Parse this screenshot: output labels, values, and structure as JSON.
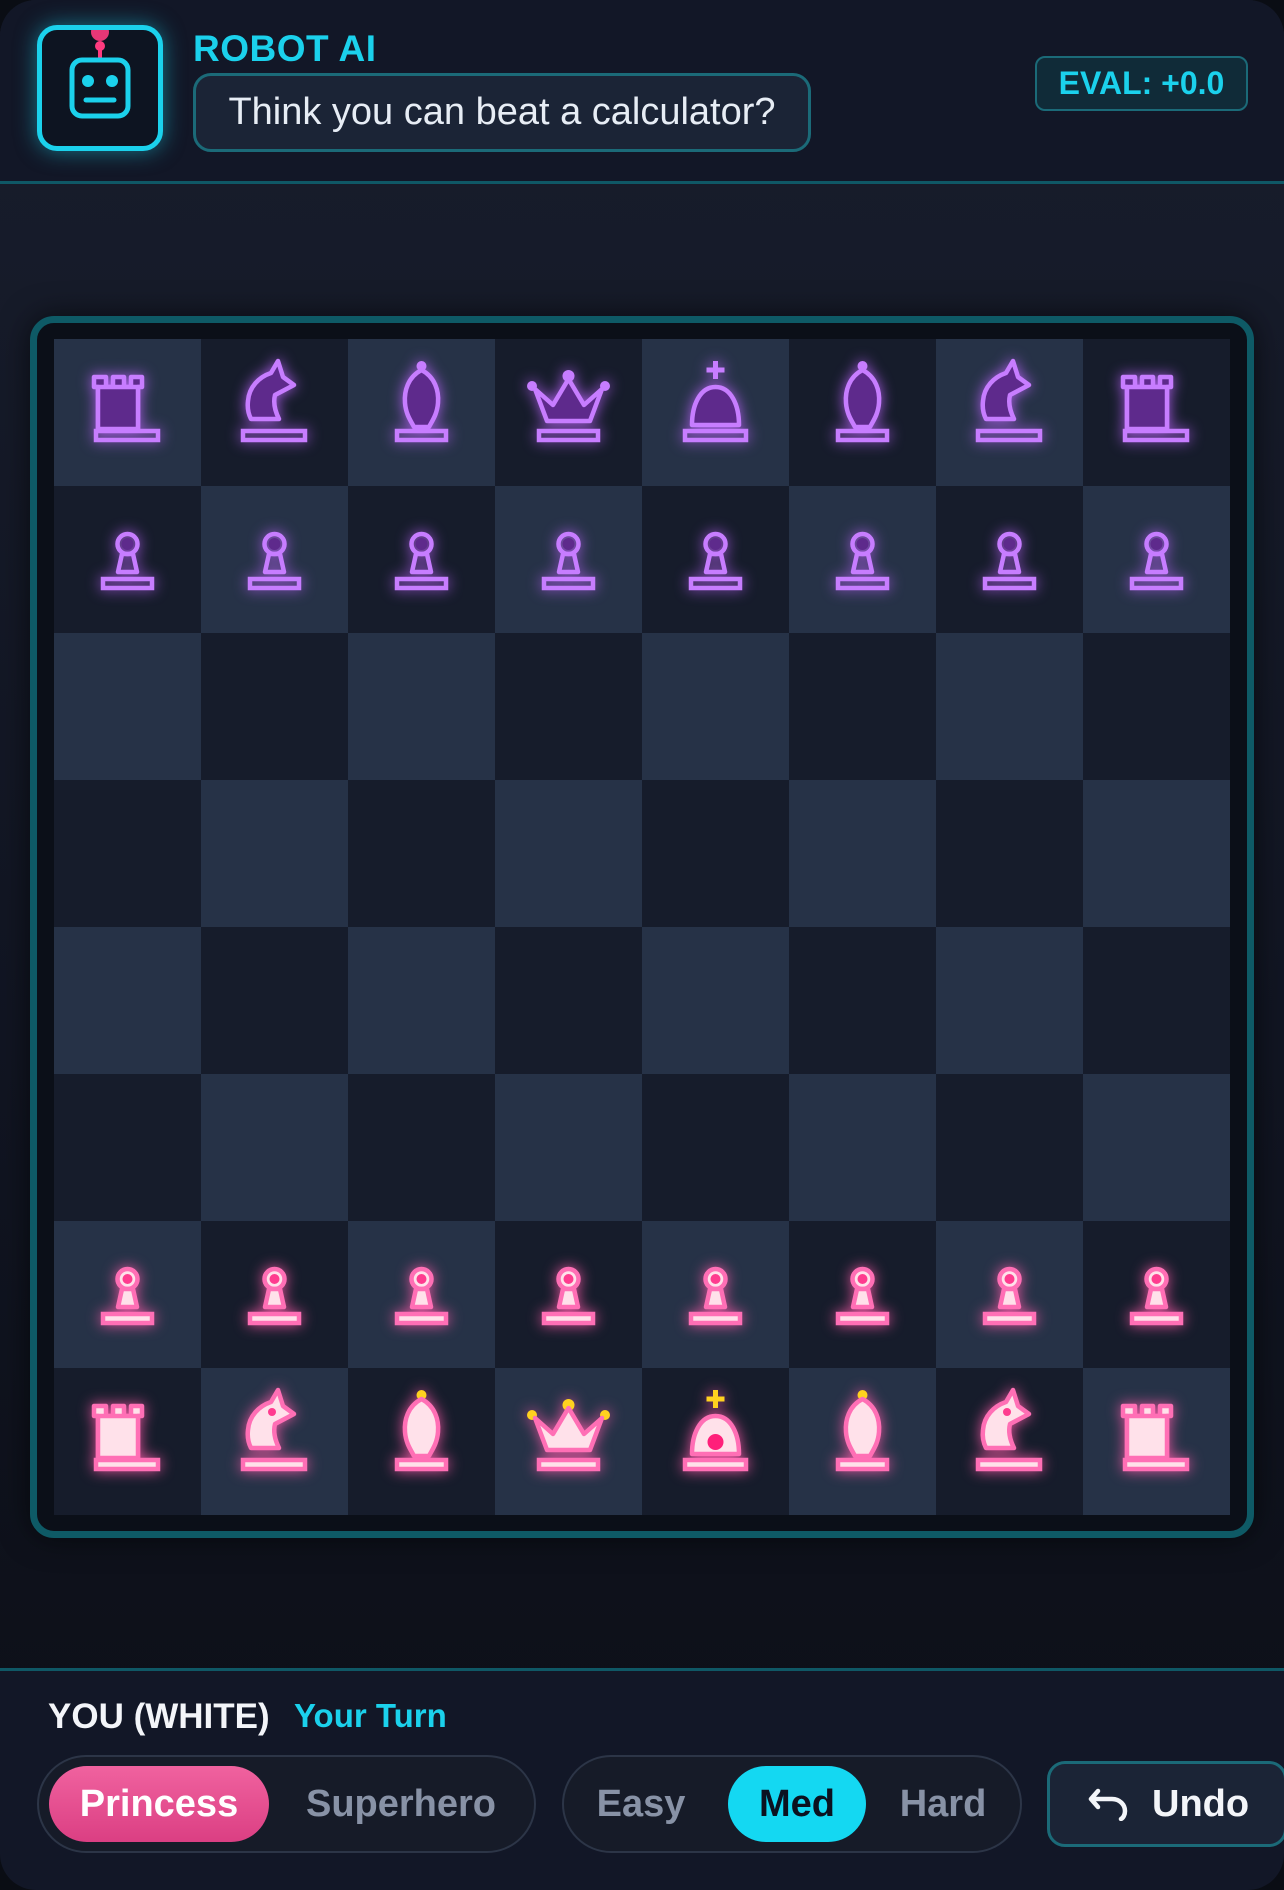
{
  "opponent": {
    "name": "ROBOT AI",
    "message": "Think you can beat a calculator?",
    "eval": "EVAL: +0.0",
    "avatar_icon": "robot-icon"
  },
  "player": {
    "label": "YOU (WHITE)",
    "status": "Your Turn"
  },
  "theme_toggle": {
    "options": [
      "Princess",
      "Superhero"
    ],
    "selected": "Princess"
  },
  "difficulty": {
    "options": [
      "Easy",
      "Med",
      "Hard"
    ],
    "selected": "Med"
  },
  "undo": {
    "label": "Undo",
    "icon": "undo-arrow-icon"
  },
  "colors": {
    "accent_cyan": "#1bd1ec",
    "accent_pink": "#ee5a9a",
    "black_pieces": "#c77dff",
    "white_pieces": "#ff6fb5",
    "light_square": "#263247",
    "dark_square": "#161c2b"
  },
  "board": {
    "ranks": [
      [
        "bR",
        "bN",
        "bB",
        "bQ",
        "bK",
        "bB",
        "bN",
        "bR"
      ],
      [
        "bP",
        "bP",
        "bP",
        "bP",
        "bP",
        "bP",
        "bP",
        "bP"
      ],
      [
        "",
        "",
        "",
        "",
        "",
        "",
        "",
        ""
      ],
      [
        "",
        "",
        "",
        "",
        "",
        "",
        "",
        ""
      ],
      [
        "",
        "",
        "",
        "",
        "",
        "",
        "",
        ""
      ],
      [
        "",
        "",
        "",
        "",
        "",
        "",
        "",
        ""
      ],
      [
        "wP",
        "wP",
        "wP",
        "wP",
        "wP",
        "wP",
        "wP",
        "wP"
      ],
      [
        "wR",
        "wN",
        "wB",
        "wQ",
        "wK",
        "wB",
        "wN",
        "wR"
      ]
    ]
  }
}
